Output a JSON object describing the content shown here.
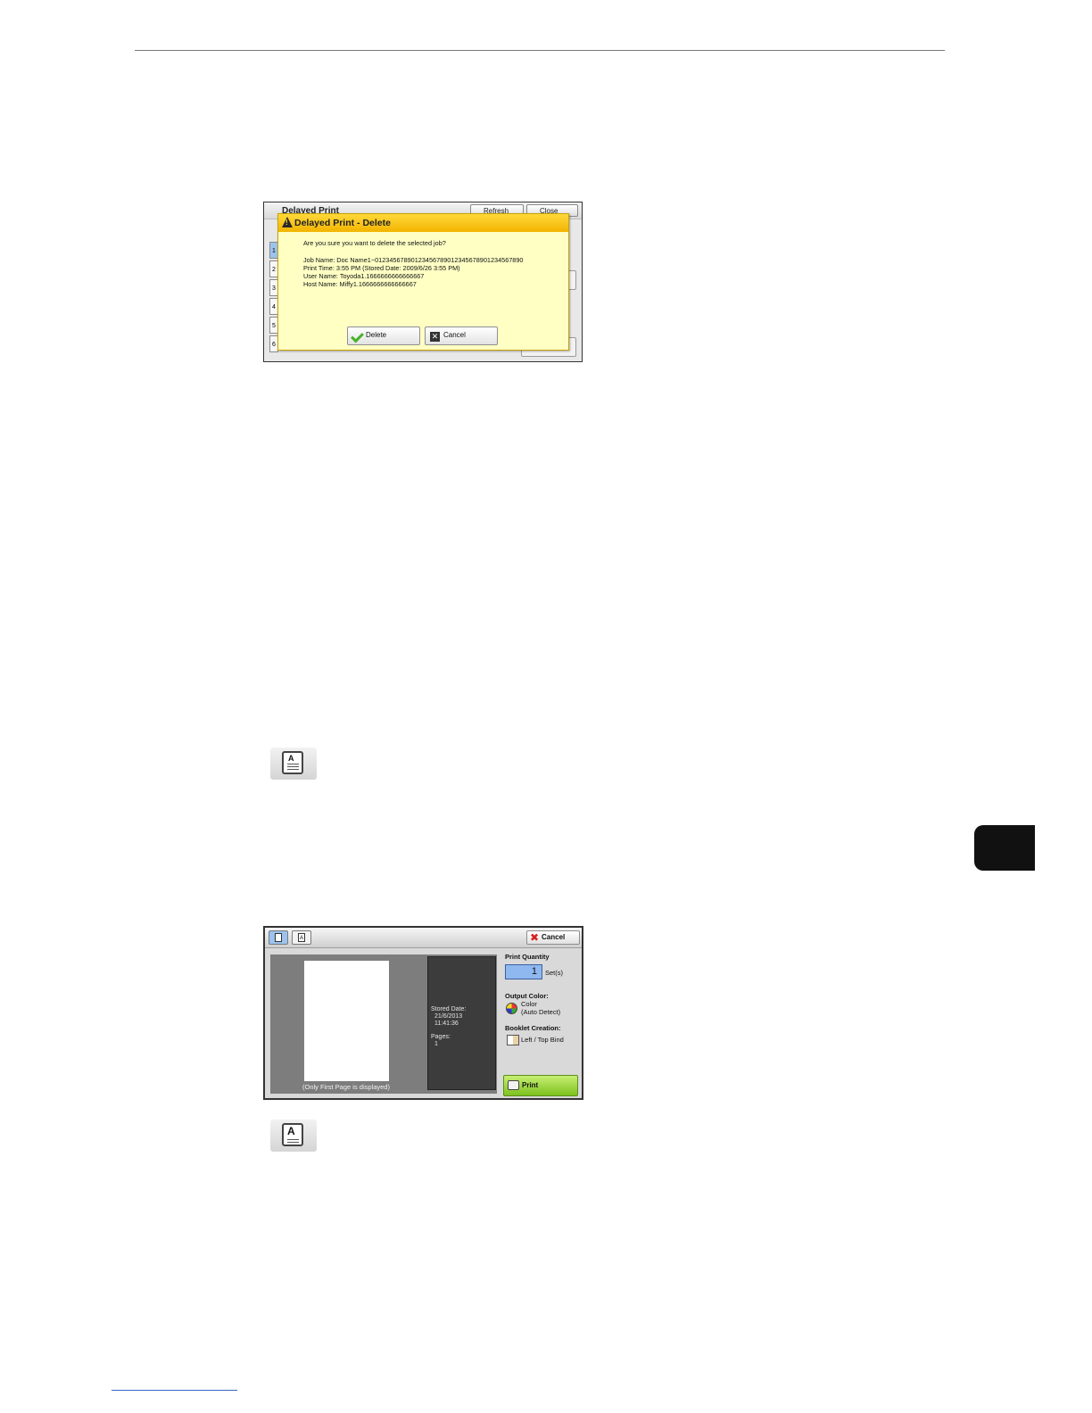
{
  "dialog_screenshot": {
    "window_title": "Delayed Print",
    "refresh_label": "Refresh",
    "close_label": "Close",
    "row_numbers": [
      "1",
      "2",
      "3",
      "4",
      "5",
      "6"
    ],
    "dialog_title": "Delayed Print - Delete",
    "question": "Are you sure you want to delete the selected job?",
    "job_name": "Job Name: Doc Name1~012345678901234567890123456789012345678​90",
    "print_time": "Print Time: 3:55 PM (Stored Date: 2009/6/26 3:55 PM)",
    "user_name": "User Name: Toyoda1.1666666666666667",
    "host_name": "Host Name: Miffy1.1666666666666667",
    "delete_label": "Delete",
    "cancel_label": "Cancel",
    "icons": {
      "warning": "warning-icon",
      "delete": "check-icon",
      "cancel": "x-icon"
    }
  },
  "preview_screenshot": {
    "cancel_label": "Cancel",
    "preview_caption": "(Only First Page is displayed)",
    "stored_date_label": "Stored Date:",
    "stored_date_value": "21/6/2013",
    "stored_time_value": "11:41:36",
    "pages_label": "Pages:",
    "pages_value": "1",
    "print_quantity_label": "Print Quantity",
    "print_quantity_value": "1",
    "sets_label": "Set(s)",
    "output_color_label": "Output Color:",
    "output_color_value": "Color",
    "output_color_detail": "(Auto Detect)",
    "booklet_label": "Booklet Creation:",
    "booklet_value": "Left / Top Bind",
    "print_label": "Print",
    "colors": {
      "print_button": "#7cc11e",
      "quantity_box": "#8fb8f0",
      "cancel_icon": "#d82020"
    }
  },
  "mode_icons": [
    "A"
  ]
}
